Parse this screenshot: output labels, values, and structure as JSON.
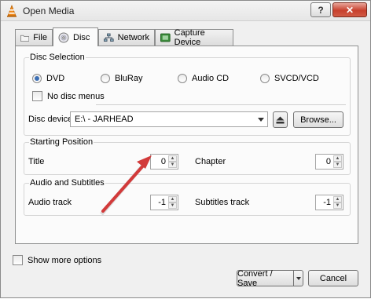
{
  "window": {
    "title": "Open Media",
    "help_label": "?",
    "close_label": "✕"
  },
  "tabs": [
    {
      "label": "File",
      "icon": "folder-icon"
    },
    {
      "label": "Disc",
      "icon": "disc-icon"
    },
    {
      "label": "Network",
      "icon": "network-icon"
    },
    {
      "label": "Capture Device",
      "icon": "capture-device-icon"
    }
  ],
  "disc_selection": {
    "title": "Disc Selection",
    "options": [
      "DVD",
      "BluRay",
      "Audio CD",
      "SVCD/VCD"
    ],
    "selected": "DVD",
    "no_menus_label": "No disc menus",
    "no_menus_checked": false,
    "device_label": "Disc device",
    "device_value": "E:\\ - JARHEAD",
    "browse_label": "Browse..."
  },
  "starting_position": {
    "title": "Starting Position",
    "title_label": "Title",
    "title_value": "0",
    "chapter_label": "Chapter",
    "chapter_value": "0"
  },
  "audio_subtitles": {
    "title": "Audio and Subtitles",
    "audio_label": "Audio track",
    "audio_value": "-1",
    "subtitles_label": "Subtitles track",
    "subtitles_value": "-1"
  },
  "footer": {
    "show_more_label": "Show more options",
    "show_more_checked": false,
    "convert_label": "Convert / Save",
    "cancel_label": "Cancel"
  },
  "annotation": {
    "arrow_color": "#d23a3a"
  }
}
